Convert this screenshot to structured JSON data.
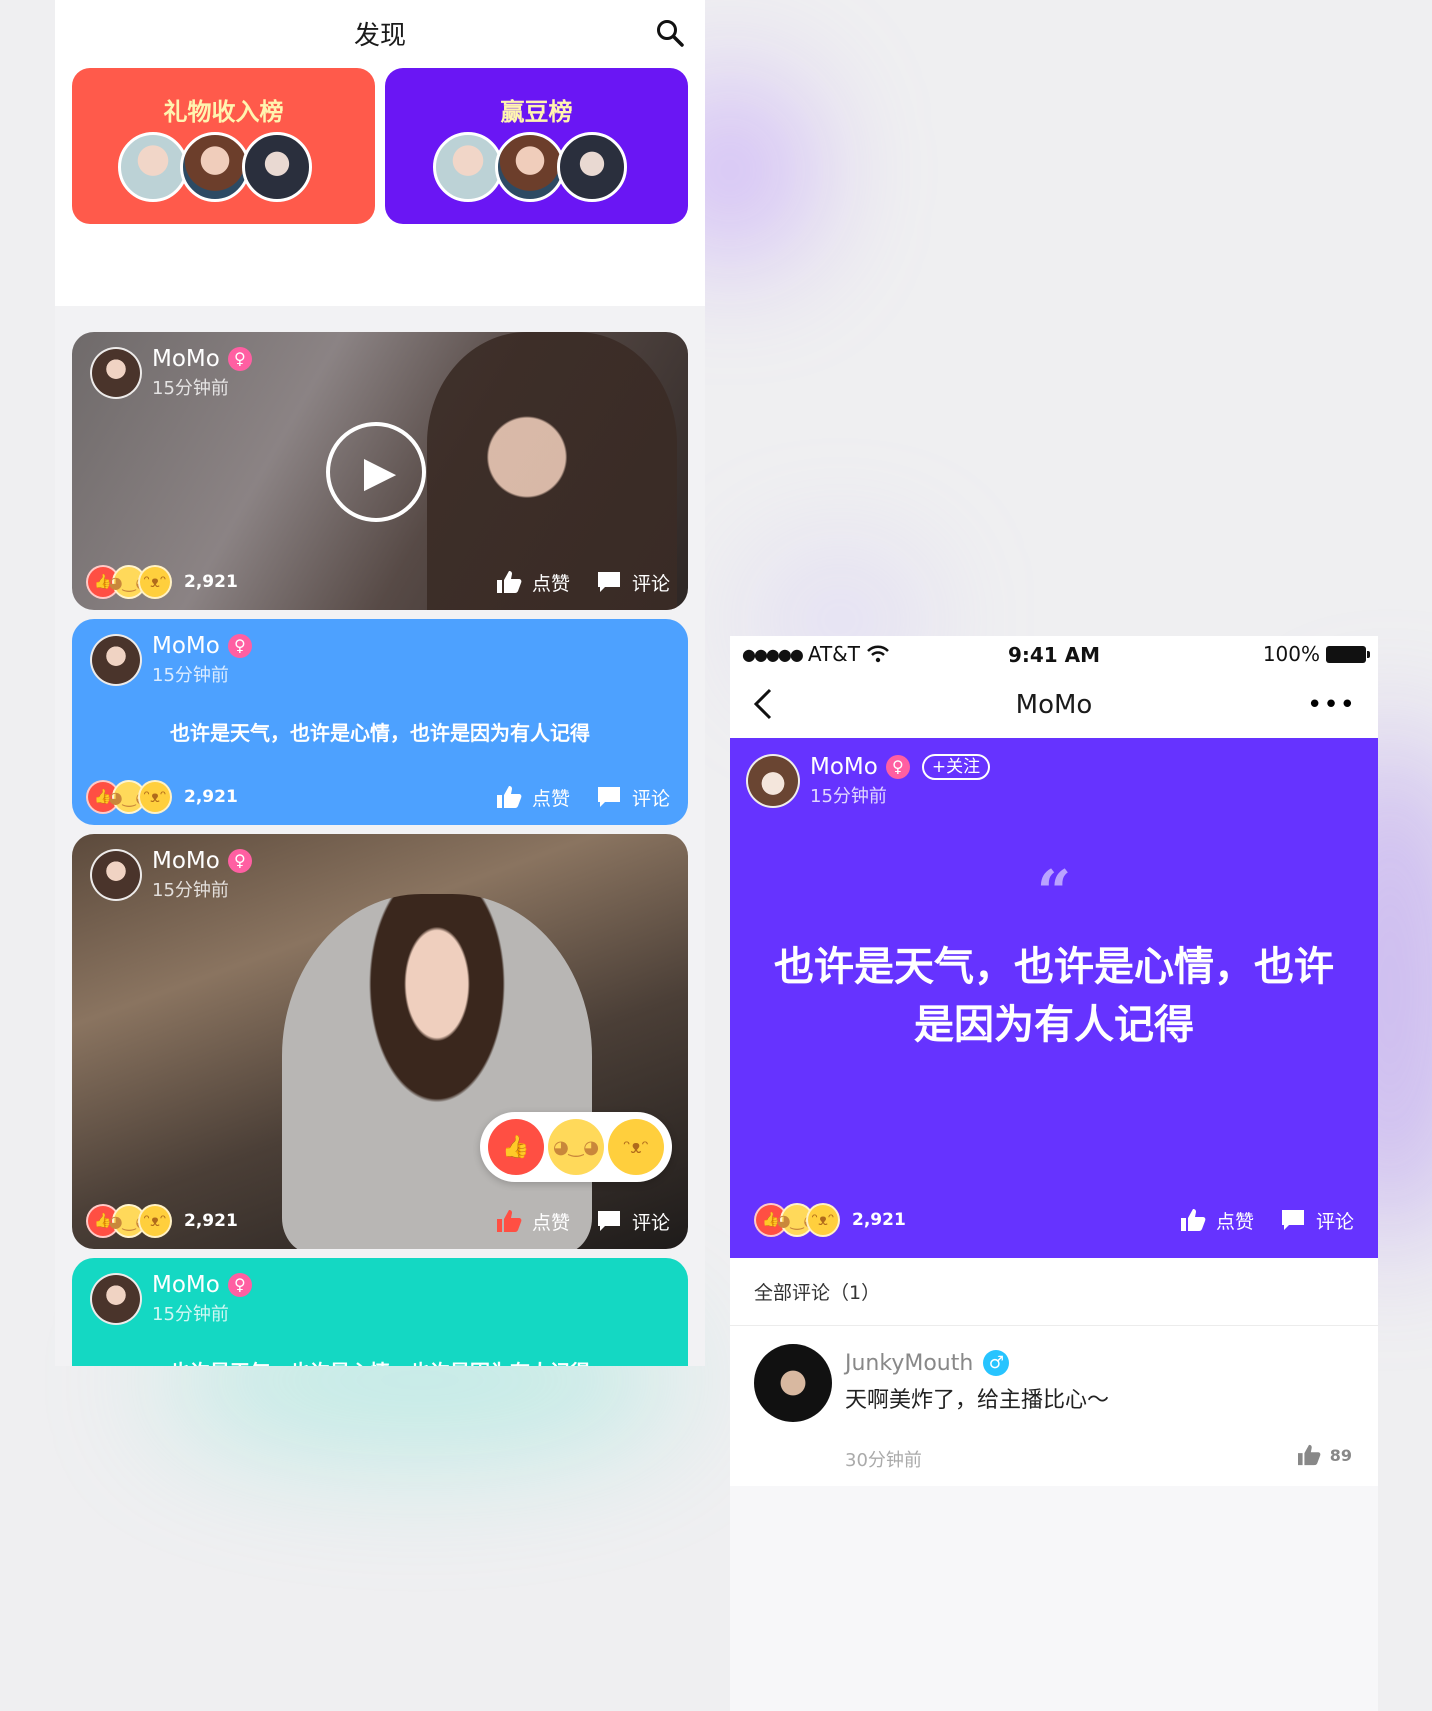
{
  "discover": {
    "title": "发现",
    "ranks": [
      {
        "label": "礼物收入榜",
        "color": "#ff5a4b"
      },
      {
        "label": "赢豆榜",
        "color": "#6a16f4"
      }
    ],
    "posts": [
      {
        "type": "video",
        "author": "MoMo",
        "gender": "♀",
        "time": "15分钟前",
        "count": "2,921",
        "like_label": "点赞",
        "comment_label": "评论"
      },
      {
        "type": "text",
        "author": "MoMo",
        "gender": "♀",
        "time": "15分钟前",
        "text": "也许是天气，也许是心情，也许是因为有人记得",
        "count": "2,921",
        "like_label": "点赞",
        "comment_label": "评论",
        "color": "#4da1ff"
      },
      {
        "type": "photo",
        "author": "MoMo",
        "gender": "♀",
        "time": "15分钟前",
        "count": "2,921",
        "like_label": "点赞",
        "comment_label": "评论"
      },
      {
        "type": "text",
        "author": "MoMo",
        "gender": "♀",
        "time": "15分钟前",
        "text": "也许是天气，也许是心情，也许是因为有人记得",
        "color": "#14d8c3"
      }
    ]
  },
  "detail": {
    "status": {
      "carrier": "AT&T",
      "time": "9:41 AM",
      "battery": "100%"
    },
    "nav_title": "MoMo",
    "post": {
      "author": "MoMo",
      "gender": "♀",
      "follow_label": "+关注",
      "time": "15分钟前",
      "quote": "“",
      "text": "也许是天气，也许是心情，也许是因为有人记得",
      "count": "2,921",
      "like_label": "点赞",
      "comment_label": "评论",
      "color": "#6633ff"
    },
    "comments_header": "全部评论（1）",
    "comments": [
      {
        "author": "JunkyMouth",
        "gender": "♂",
        "text": "天啊美炸了，给主播比心～",
        "time": "30分钟前",
        "likes": "89"
      }
    ]
  },
  "icons": [
    "search-icon",
    "play-icon",
    "thumb-up-icon",
    "comment-icon",
    "back-icon",
    "more-icon",
    "female-icon",
    "male-icon"
  ]
}
